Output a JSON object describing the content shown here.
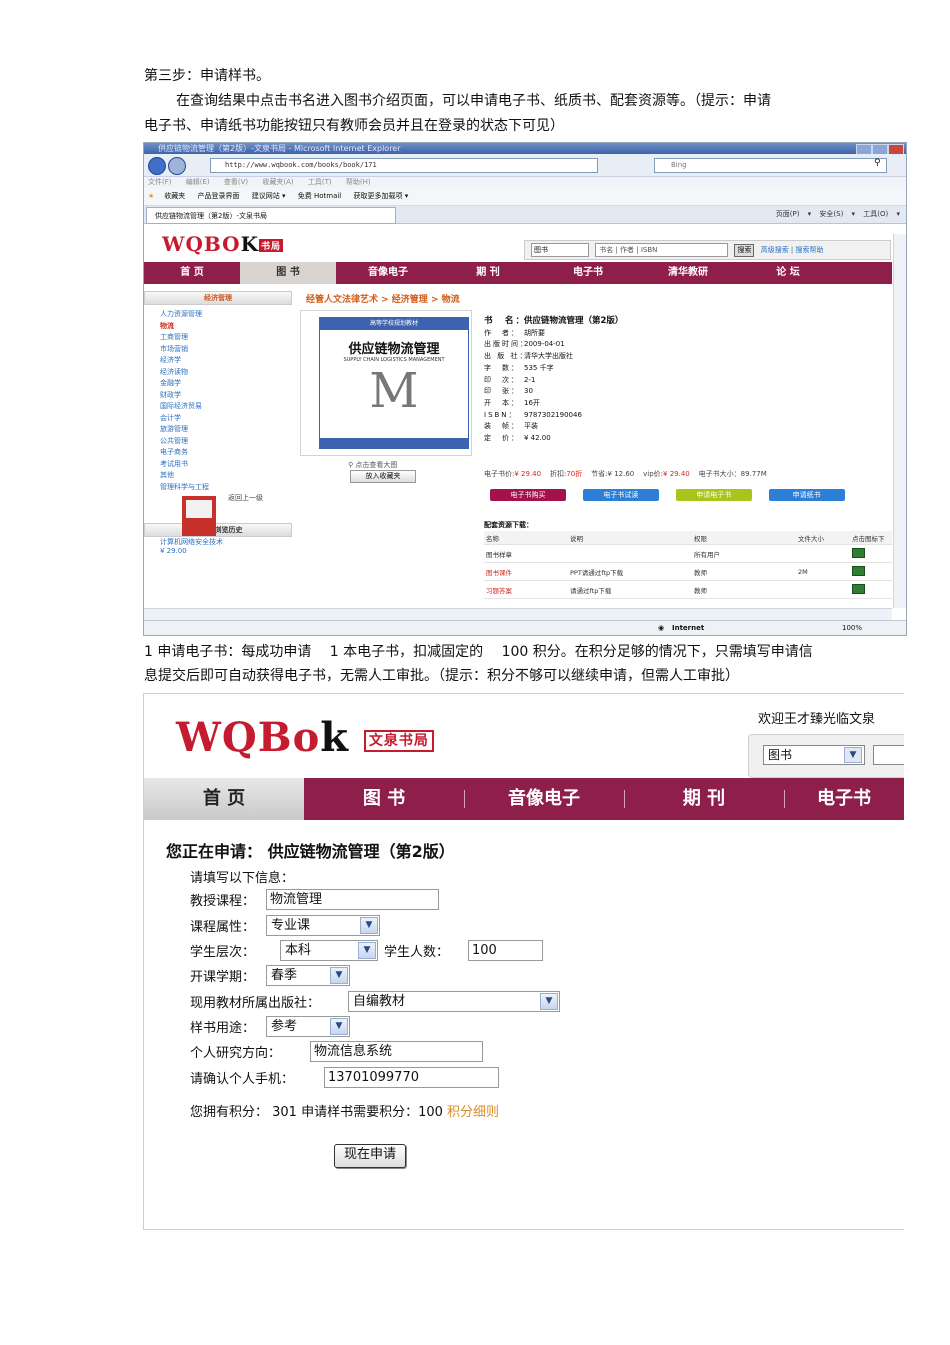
{
  "doc": {
    "step_title": "第三步：申请样书。",
    "intro_line1": "在查询结果中点击书名进入图书介绍页面，可以申请电子书、纸质书、配套资源等。（提示：申请",
    "intro_line2": "电子书、申请纸书功能按钮只有教师会员并且在登录的状态下可见）",
    "note_line1": "1 申请电子书：每成功申请 　1 本电子书，扣减固定的 　100 积分。在积分足够的情况下，只需填写申请信",
    "note_line2": "息提交后即可自动获得电子书，无需人工审批。（提示：积分不够可以继续申请，但需人工审批）"
  },
  "browser": {
    "window_title": "供应链物流管理（第2版）-文泉书局 - Microsoft Internet Explorer",
    "address": "http://www.wqbook.com/books/book/171",
    "search_engine": "Bing",
    "menu": [
      "文件(F)",
      "编辑(E)",
      "查看(V)",
      "收藏夹(A)",
      "工具(T)",
      "帮助(H)"
    ],
    "favorites": [
      "收藏夹",
      "产品登录界面",
      "建议网站 ▾",
      "免费 Hotmail",
      "获取更多加载项 ▾"
    ],
    "tab_title": "供应链物流管理（第2版）-文泉书局",
    "tools_bar": "页面(P) ▾  安全(S) ▾  工具(O) ▾",
    "status_zone": "Internet",
    "zoom": "100%"
  },
  "site_small": {
    "logo_text": "WQBO",
    "logo_k": "K",
    "logo_seal": "书局",
    "search_select": "图书",
    "search_placeholder": "书名 | 作者 | ISBN",
    "search_button": "搜索",
    "adv_links": "高级搜索 | 搜索帮助",
    "nav": [
      "首 页",
      "图 书",
      "音像电子",
      "期 刊",
      "电子书",
      "清华教研",
      "论 坛"
    ],
    "sidebar_title": "经济管理",
    "sidebar_items": [
      "人力资源管理",
      "物流",
      "工商管理",
      "市场营销",
      "经济学",
      "经济读物",
      "金融学",
      "财政学",
      "国际经济贸易",
      "会计学",
      "旅游管理",
      "公共管理",
      "电子商务",
      "考试用书",
      "其他",
      "管理科学与工程"
    ],
    "sidebar_back": "返回上一级",
    "history_title": "最近的浏览历史",
    "history_item": "计算机网络安全技术",
    "history_price": "¥ 29.00",
    "breadcrumb": "经管人文法律艺术 > 经济管理 > 物流",
    "cover": {
      "band": "高等学校规划教材",
      "title": "供应链物流管理",
      "subtitle": "SUPPLY CHAIN LOGISTICS MANAGEMENT",
      "letter": "M"
    },
    "zoom_link": "点击查看大图",
    "fav_button": "放入收藏夹",
    "info": [
      {
        "k": "书　名：",
        "v": "供应链物流管理（第2版）"
      },
      {
        "k": "作　者：",
        "v": "胡所要"
      },
      {
        "k": "出版时间：",
        "v": "2009-04-01"
      },
      {
        "k": "出 版 社：",
        "v": "清华大学出版社"
      },
      {
        "k": "字　数：",
        "v": "535 千字"
      },
      {
        "k": "印　次：",
        "v": "2-1"
      },
      {
        "k": "印　张：",
        "v": "30"
      },
      {
        "k": "开　本：",
        "v": "16开"
      },
      {
        "k": "ISBN：",
        "v": "9787302190046"
      },
      {
        "k": "装　帧：",
        "v": "平装"
      },
      {
        "k": "定　价：",
        "v": "¥ 42.00"
      }
    ],
    "prices": {
      "ebook_label": "电子书价:",
      "ebook_price": "¥ 29.40",
      "discount_label": "折扣:",
      "discount": "70折",
      "save_label": "节省:",
      "save": "¥ 12.60",
      "vip_label": "vip价:",
      "vip": "¥ 29.40",
      "size_label": "电子书大小：",
      "size": "89.77M"
    },
    "buttons": [
      {
        "label": "电子书购买",
        "color": "#a3124f"
      },
      {
        "label": "电子书试读",
        "color": "#2c7fd4"
      },
      {
        "label": "申请电子书",
        "color": "#a9c41b"
      },
      {
        "label": "申请纸书",
        "color": "#2c7fd4"
      }
    ],
    "res_title": "配套资源下载：",
    "res_headers": [
      "名称",
      "说明",
      "权限",
      "文件大小",
      "点击图标下"
    ],
    "res_rows": [
      {
        "name": "图书样章",
        "desc": "",
        "perm": "所有用户",
        "size": ""
      },
      {
        "name": "图书课件",
        "desc": "PPT请通过ftp下载",
        "perm": "教师",
        "size": "2M"
      },
      {
        "name": "习题答案",
        "desc": "请通过ftp下载",
        "perm": "教师",
        "size": ""
      }
    ]
  },
  "site_large": {
    "logo_text": "WQBo",
    "logo_k": "k",
    "logo_seal": "文泉书局",
    "welcome": "欢迎王才臻光临文泉",
    "search_select": "图书",
    "nav": [
      "首 页",
      "图 书",
      "音像电子",
      "期 刊",
      "电子书"
    ],
    "apply_title": "您正在申请：  供应链物流管理（第2版）",
    "form": {
      "intro": "请填写以下信息：",
      "course_label": "教授课程：",
      "course_value": "物流管理",
      "type_label": "课程属性：",
      "type_value": "专业课",
      "level_label": "学生层次：",
      "level_value": "本科",
      "count_label": "学生人数：",
      "count_value": "100",
      "term_label": "开课学期：",
      "term_value": "春季",
      "publisher_label": "现用教材所属出版社：",
      "publisher_value": "自编教材",
      "usage_label": "样书用途：",
      "usage_value": "参考",
      "research_label": "个人研究方向：",
      "research_value": "物流信息系统",
      "phone_label": "请确认个人手机：",
      "phone_value": "13701099770"
    },
    "points_text": "您拥有积分： 301 申请样书需要积分：100 ",
    "points_rule": "积分细则",
    "submit": "现在申请"
  }
}
